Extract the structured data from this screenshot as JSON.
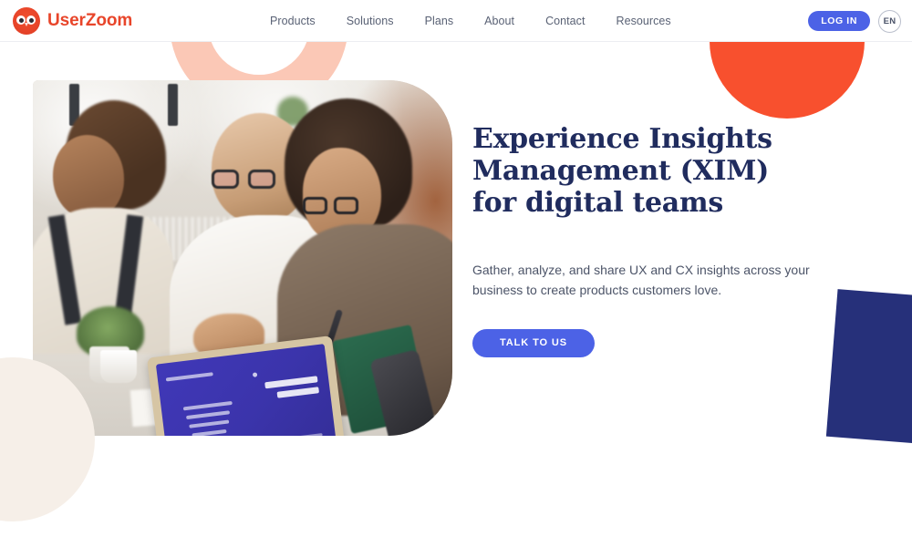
{
  "header": {
    "logo": {
      "icon": "owl-icon",
      "text": "UserZoom",
      "color": "#e8452a"
    },
    "nav_items": [
      {
        "label": "Products"
      },
      {
        "label": "Solutions"
      },
      {
        "label": "Plans"
      },
      {
        "label": "About"
      },
      {
        "label": "Contact"
      },
      {
        "label": "Resources"
      }
    ],
    "login_label": "LOG IN",
    "language_label": "EN"
  },
  "hero": {
    "headline": "Experience Insights Management (XIM) for digital teams",
    "subtext": "Gather, analyze, and share UX and CX insights across your business to create products customers love.",
    "cta_label": "TALK TO US",
    "image_alt": "Three colleagues collaborating at a desk with a tablet"
  },
  "colors": {
    "brand_red": "#e8452a",
    "accent_blue": "#4c62e6",
    "headline_navy": "#202c5e",
    "deco_orange": "#f8502e",
    "deco_peach": "#fbc8b6",
    "deco_navy": "#26307a",
    "deco_cream": "#f6efe8"
  }
}
